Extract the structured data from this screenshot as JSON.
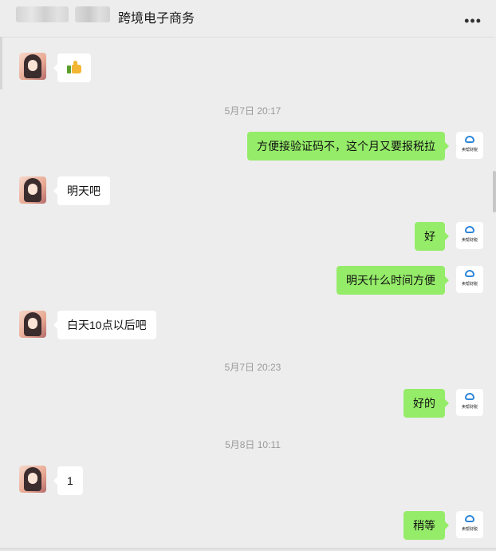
{
  "chat": {
    "title": "跨境电子商务",
    "more_icon": "more-horizontal-icon"
  },
  "partner_avatar": {
    "icon": "partner-avatar-icon"
  },
  "self_avatar": {
    "label": "卖帮财税",
    "icon": "cloud-logo-icon"
  },
  "messages": [
    {
      "side": "in",
      "text": "",
      "emoji": "thumbs-up-icon"
    },
    {
      "type": "time",
      "text": "5月7日 20:17"
    },
    {
      "side": "out",
      "text": "方便接验证码不，这个月又要报税拉"
    },
    {
      "side": "in",
      "text": "明天吧"
    },
    {
      "side": "out",
      "text": "好"
    },
    {
      "side": "out",
      "text": "明天什么时间方便"
    },
    {
      "side": "in",
      "text": "白天10点以后吧"
    },
    {
      "type": "time",
      "text": "5月7日 20:23"
    },
    {
      "side": "out",
      "text": "好的"
    },
    {
      "type": "time",
      "text": "5月8日 10:11"
    },
    {
      "side": "in",
      "text": "1"
    },
    {
      "side": "out",
      "text": "稍等"
    }
  ]
}
